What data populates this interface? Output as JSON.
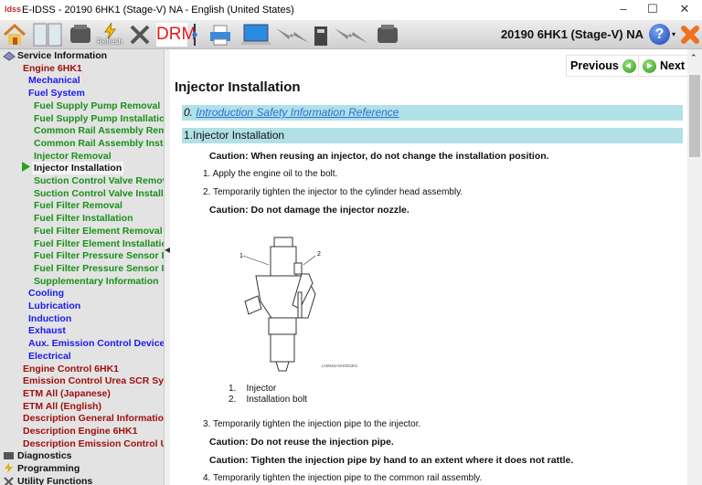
{
  "window": {
    "logo": "Idss",
    "title": "E-IDSS - 20190 6HK1 (Stage-V)  NA - English (United States)",
    "minimize": "–",
    "maximize": "☐",
    "close": "✕"
  },
  "toolbar": {
    "refresh_label": "Refresh",
    "drm_label": "DRM",
    "model": "20190 6HK1 (Stage-V)  NA",
    "help": "?"
  },
  "tree": {
    "root": "Service Information",
    "items": [
      {
        "label": "Engine 6HK1",
        "level": 1
      },
      {
        "label": "Mechanical",
        "level": 2
      },
      {
        "label": "Fuel System",
        "level": 2
      },
      {
        "label": "Fuel Supply Pump Removal",
        "level": 3
      },
      {
        "label": "Fuel Supply Pump Installation",
        "level": 3
      },
      {
        "label": "Common Rail Assembly Removal",
        "level": 3
      },
      {
        "label": "Common Rail Assembly Installation",
        "level": 3
      },
      {
        "label": "Injector Removal",
        "level": 3
      },
      {
        "label": "Injector Installation",
        "level": 3,
        "selected": true
      },
      {
        "label": "Suction Control Valve Removal",
        "level": 3
      },
      {
        "label": "Suction Control Valve Installation",
        "level": 3
      },
      {
        "label": "Fuel Filter Removal",
        "level": 3
      },
      {
        "label": "Fuel Filter Installation",
        "level": 3
      },
      {
        "label": "Fuel Filter Element Removal",
        "level": 3
      },
      {
        "label": "Fuel Filter Element Installation",
        "level": 3
      },
      {
        "label": "Fuel Filter Pressure Sensor Removal",
        "level": 3
      },
      {
        "label": "Fuel Filter Pressure Sensor Installation",
        "level": 3
      },
      {
        "label": "Supplementary Information",
        "level": 3
      },
      {
        "label": "Cooling",
        "level": 2
      },
      {
        "label": "Lubrication",
        "level": 2
      },
      {
        "label": "Induction",
        "level": 2
      },
      {
        "label": "Exhaust",
        "level": 2
      },
      {
        "label": "Aux. Emission Control Devices",
        "level": 2
      },
      {
        "label": "Electrical",
        "level": 2
      },
      {
        "label": "Engine Control 6HK1",
        "level": 1
      },
      {
        "label": "Emission Control Urea SCR System",
        "level": 1
      },
      {
        "label": "ETM All (Japanese)",
        "level": 1
      },
      {
        "label": "ETM All (English)",
        "level": 1
      },
      {
        "label": "Description General Information",
        "level": 1
      },
      {
        "label": "Description Engine 6HK1",
        "level": 1
      },
      {
        "label": "Description Emission Control Urea",
        "level": 1
      }
    ],
    "bottom": [
      "Diagnostics",
      "Programming",
      "Utility Functions"
    ]
  },
  "content": {
    "previous": "Previous",
    "next": "Next",
    "title": "Injector Installation",
    "ref_num": "0.",
    "ref_link": "Introduction Safety Information Reference",
    "section": "1.Injector Installation",
    "caution1": "Caution: When reusing an injector, do not change the installation position.",
    "step1": "1. Apply the engine oil to the bolt.",
    "step2": "2. Temporarily tighten the injector to the cylinder head assembly.",
    "caution2": "Caution: Do not damage the injector nozzle.",
    "figure": {
      "callout1": "1",
      "callout2": "2",
      "code": "LNW46ASH004301"
    },
    "legend": [
      {
        "n": "1.",
        "label": "Injector"
      },
      {
        "n": "2.",
        "label": "Installation bolt"
      }
    ],
    "step3": "3. Temporarily tighten the injection pipe to the injector.",
    "caution3": "Caution: Do not reuse the injection pipe.",
    "caution4": "Caution: Tighten the injection pipe by hand to an extent where it does not rattle.",
    "step4": "4. Temporarily tighten the injection pipe to the common rail assembly."
  }
}
